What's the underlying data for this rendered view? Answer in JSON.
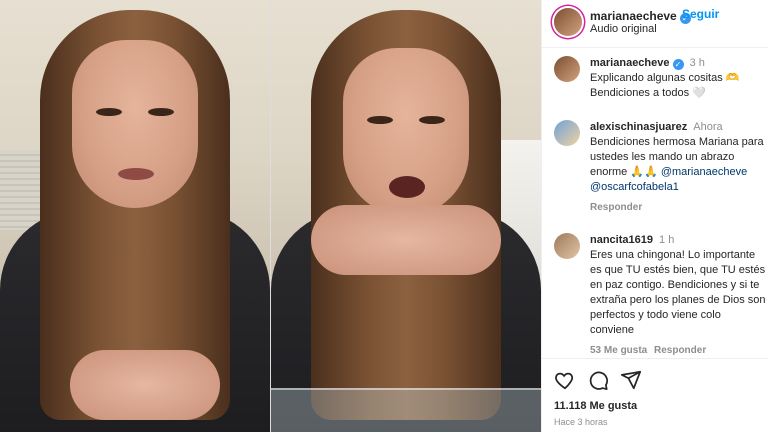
{
  "header": {
    "username": "marianaecheve",
    "follow_label": "Seguir",
    "audio_label": "Audio original"
  },
  "caption": {
    "username": "marianaecheve",
    "time": "3 h",
    "line1": "Explicando algunas cositas 🫶",
    "line2": "Bendiciones a todos 🤍"
  },
  "comments": [
    {
      "username": "alexischinasjuarez",
      "time": "Ahora",
      "text": "Bendiciones hermosa Mariana para ustedes les mando un abrazo enorme 🙏🙏",
      "mention1": "@marianaecheve",
      "mention2": "@oscarfcofabela1",
      "reply_label": "Responder"
    },
    {
      "username": "nancita1619",
      "time": "1 h",
      "text": "Eres una chingona! Lo importante es que TU estés bien, que TU estés en paz contigo. Bendiciones y si te extraña pero los planes de Dios son perfectos y todo viene colo conviene",
      "likes_label": "53 Me gusta",
      "reply_label": "Responder"
    }
  ],
  "actions": {
    "like_icon": "heart-icon",
    "comment_icon": "comment-icon",
    "share_icon": "send-icon",
    "likes_count": "11.118 Me gusta",
    "posted_ago": "Hace 3 horas"
  },
  "colors": {
    "accent": "#0095f6",
    "verified": "#3897f0",
    "muted": "#8e8e8e"
  }
}
